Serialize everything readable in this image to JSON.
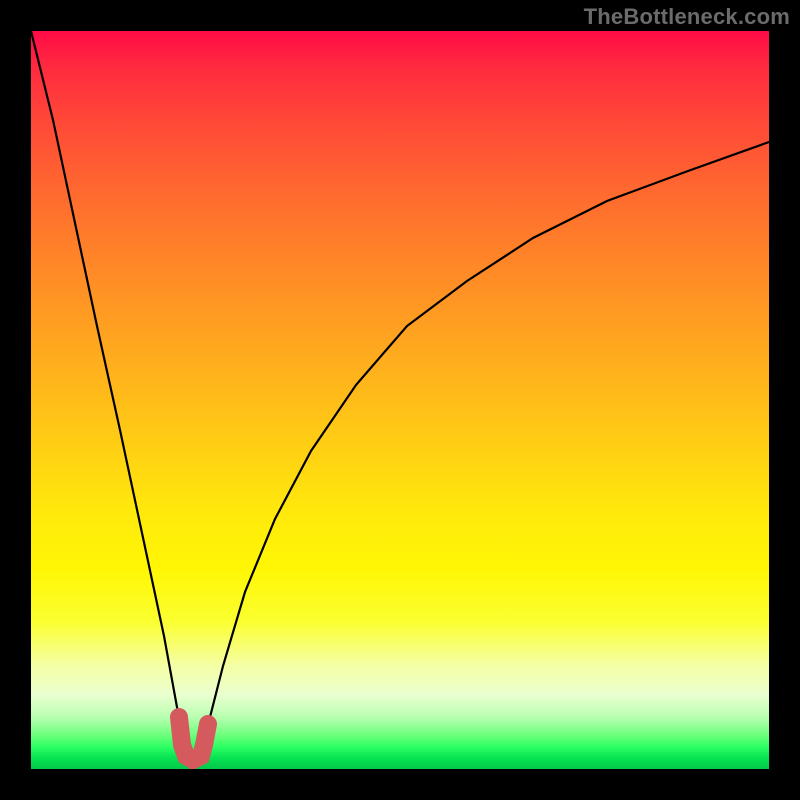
{
  "watermark": "TheBottleneck.com",
  "chart_data": {
    "type": "line",
    "title": "",
    "xlabel": "",
    "ylabel": "",
    "xlim": [
      0,
      100
    ],
    "ylim": [
      0,
      100
    ],
    "grid": false,
    "legend": false,
    "series": [
      {
        "name": "curve",
        "x": [
          0,
          3,
          6,
          9,
          12,
          15,
          18,
          20,
          20.5,
          21,
          22,
          23,
          23.5,
          24,
          26,
          29,
          33,
          38,
          44,
          51,
          59,
          68,
          78,
          89,
          100
        ],
        "y": [
          100,
          88,
          74,
          60,
          46,
          32,
          18,
          7,
          3,
          1.5,
          1,
          1.5,
          3,
          6,
          14,
          24,
          34,
          43,
          52,
          60,
          66,
          72,
          77,
          81,
          85
        ]
      }
    ],
    "annotations": [
      {
        "name": "valley-marker",
        "x_range": [
          20,
          24
        ],
        "color": "#d45a5e"
      }
    ]
  },
  "colors": {
    "curve": "#000000",
    "valley_marker": "#d45a5e",
    "frame": "#000000"
  }
}
